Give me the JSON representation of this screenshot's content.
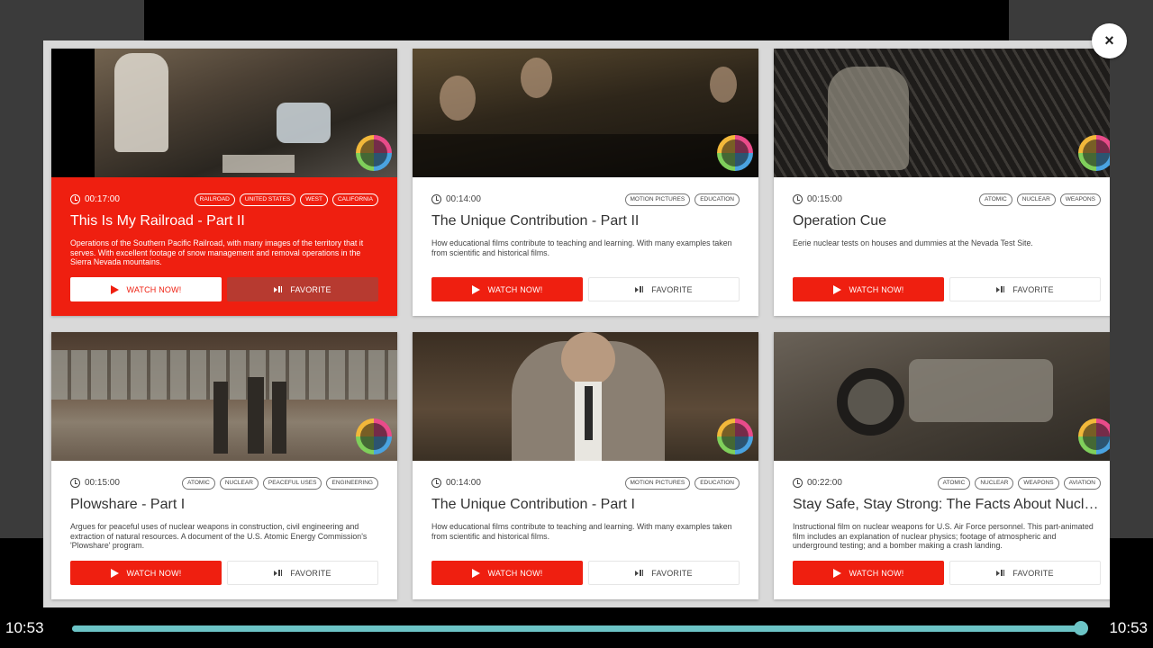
{
  "player": {
    "time_current": "10:53",
    "time_total": "10:53",
    "progress": 1.0,
    "accent": "#6cc4c6"
  },
  "close_label": "×",
  "buttons": {
    "watch": "WATCH NOW!",
    "favorite": "FAVORITE"
  },
  "cards": [
    {
      "duration": "00:17:00",
      "tags": [
        "RAILROAD",
        "UNITED STATES",
        "WEST",
        "CALIFORNIA"
      ],
      "title": "This Is My Railroad - Part II",
      "description": "Operations of the Southern Pacific Railroad, with many images of the territory that it serves. With excellent footage of snow management and removal operations in the Sierra Nevada mountains.",
      "active": true
    },
    {
      "duration": "00:14:00",
      "tags": [
        "MOTION PICTURES",
        "EDUCATION"
      ],
      "title": "The Unique Contribution - Part II",
      "description": "How educational films contribute to teaching and learning. With many examples taken from scientific and historical films.",
      "active": false
    },
    {
      "duration": "00:15:00",
      "tags": [
        "ATOMIC",
        "NUCLEAR",
        "WEAPONS"
      ],
      "title": "Operation Cue",
      "description": "Eerie nuclear tests on houses and dummies at the Nevada Test Site.",
      "active": false
    },
    {
      "duration": "00:15:00",
      "tags": [
        "ATOMIC",
        "NUCLEAR",
        "PEACEFUL USES",
        "ENGINEERING"
      ],
      "title": "Plowshare - Part I",
      "description": "Argues for peaceful uses of nuclear weapons in construction, civil engineering and extraction of natural resources. A document of the U.S. Atomic Energy Commission's 'Plowshare' program.",
      "active": false
    },
    {
      "duration": "00:14:00",
      "tags": [
        "MOTION PICTURES",
        "EDUCATION"
      ],
      "title": "The Unique Contribution - Part I",
      "description": "How educational films contribute to teaching and learning. With many examples taken from scientific and historical films.",
      "active": false
    },
    {
      "duration": "00:22:00",
      "tags": [
        "ATOMIC",
        "NUCLEAR",
        "WEAPONS",
        "AVIATION"
      ],
      "title": "Stay Safe, Stay Strong: The Facts About Nuclear Weapons",
      "description": "Instructional film on nuclear weapons for U.S. Air Force personnel. This part-animated film includes an explanation of nuclear physics; footage of atmospheric and underground testing; and a bomber making a crash landing.",
      "active": false
    }
  ]
}
